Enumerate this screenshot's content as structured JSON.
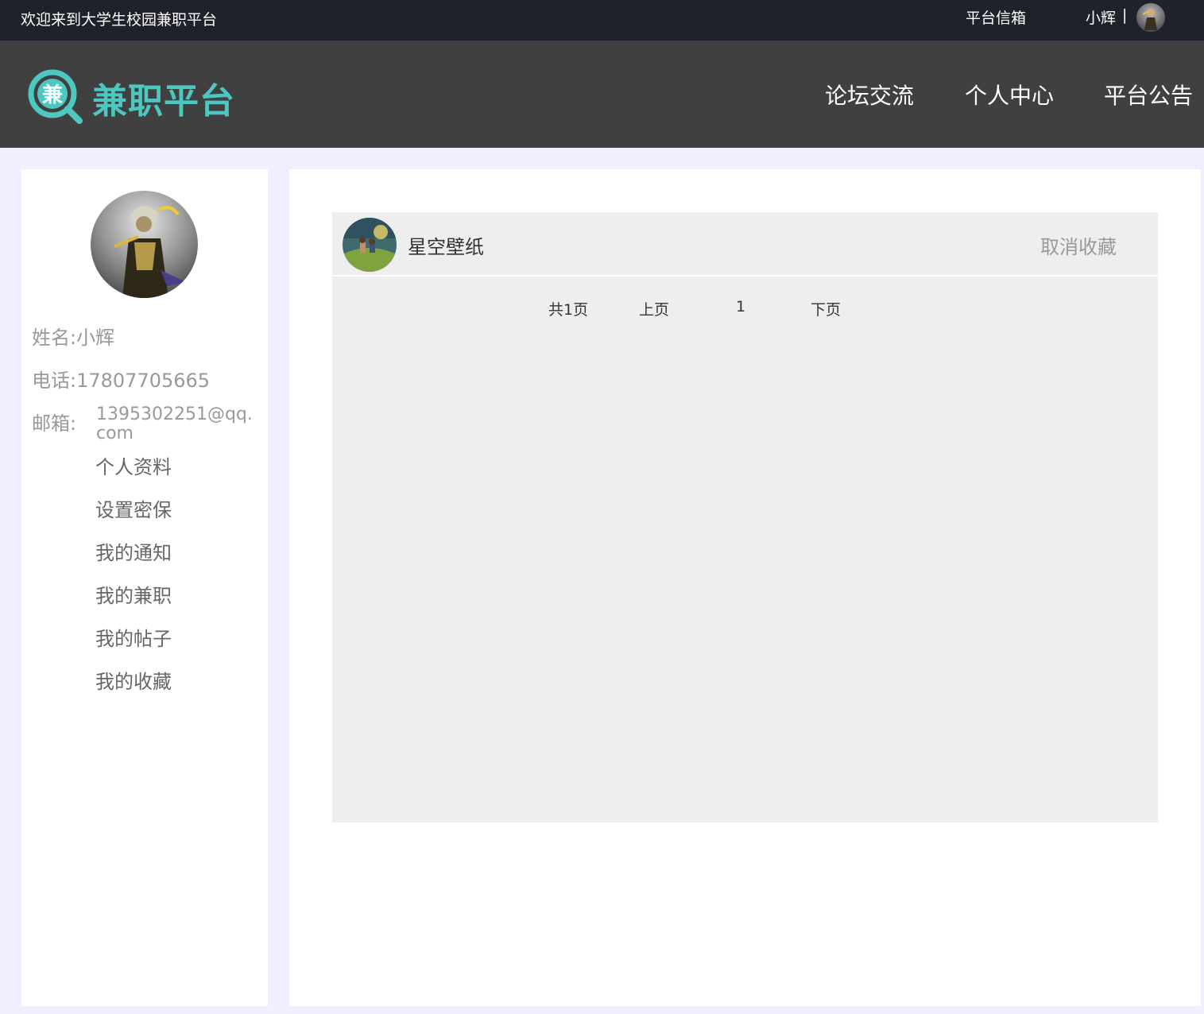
{
  "topbar": {
    "welcome": "欢迎来到大学生校园兼职平台",
    "mailbox": "平台信箱",
    "username": "小辉",
    "separator": "|"
  },
  "navbar": {
    "logo_glyph": "兼",
    "logo_text": "兼职平台",
    "items": [
      "论坛交流",
      "个人中心",
      "平台公告"
    ]
  },
  "profile": {
    "name_label": "姓名:",
    "name": "小辉",
    "phone_label": "电话:",
    "phone": "17807705665",
    "email_label": "邮箱:",
    "email": "1395302251@qq.com"
  },
  "menu": [
    "个人资料",
    "设置密保",
    "我的通知",
    "我的兼职",
    "我的帖子",
    "我的收藏"
  ],
  "favorites": [
    {
      "title": "星空壁纸",
      "action": "取消收藏"
    }
  ],
  "pagination": {
    "total": "共1页",
    "prev": "上页",
    "current": "1",
    "next": "下页"
  },
  "colors": {
    "topbar_bg": "#20222b",
    "navbar_bg": "#404040",
    "brand": "#4dc7c0",
    "page_bg": "#f0efff"
  }
}
